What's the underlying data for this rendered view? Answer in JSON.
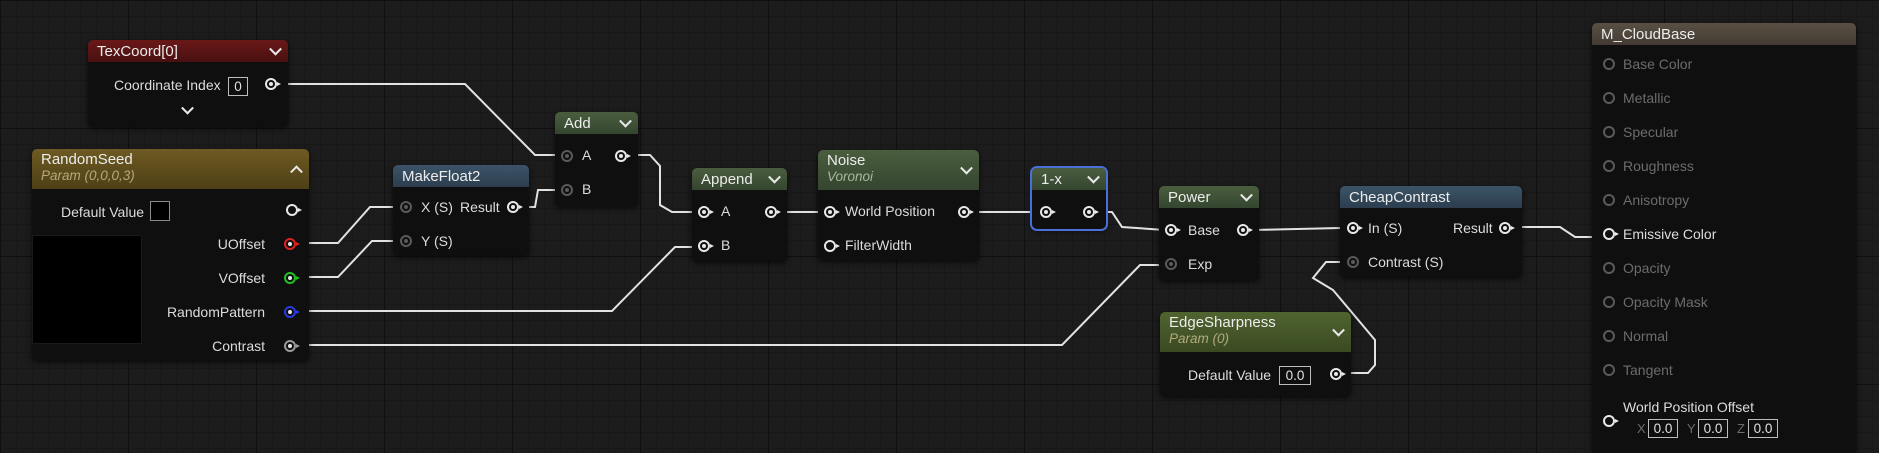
{
  "nodes": {
    "texcoord": {
      "title": "TexCoord[0]",
      "coordinate_index_label": "Coordinate Index",
      "coordinate_index_value": "0"
    },
    "random_seed": {
      "title": "RandomSeed",
      "subtitle": "Param (0,0,0,3)",
      "default_value_label": "Default Value",
      "outputs": [
        "UOffset",
        "VOffset",
        "RandomPattern",
        "Contrast"
      ]
    },
    "make_float2": {
      "title": "MakeFloat2",
      "inputs": [
        "X (S)",
        "Y (S)"
      ],
      "output": "Result"
    },
    "add": {
      "title": "Add",
      "inputs": [
        "A",
        "B"
      ]
    },
    "append": {
      "title": "Append",
      "inputs": [
        "A",
        "B"
      ]
    },
    "noise": {
      "title": "Noise",
      "subtitle": "Voronoi",
      "inputs": [
        "World Position",
        "FilterWidth"
      ]
    },
    "one_minus": {
      "title": "1-x"
    },
    "power": {
      "title": "Power",
      "inputs": [
        "Base",
        "Exp"
      ]
    },
    "edge_sharpness": {
      "title": "EdgeSharpness",
      "subtitle": "Param (0)",
      "default_value_label": "Default Value",
      "default_value": "0.0"
    },
    "cheap_contrast": {
      "title": "CheapContrast",
      "inputs": [
        "In (S)",
        "Contrast (S)"
      ],
      "output": "Result"
    },
    "material": {
      "title": "M_CloudBase",
      "inputs": [
        "Base Color",
        "Metallic",
        "Specular",
        "Roughness",
        "Anisotropy",
        "Emissive Color",
        "Opacity",
        "Opacity Mask",
        "Normal",
        "Tangent"
      ],
      "wpo_label": "World Position Offset",
      "wpo": {
        "x_label": "X",
        "x": "0.0",
        "y_label": "Y",
        "y": "0.0",
        "z_label": "Z",
        "z": "0.0"
      }
    }
  },
  "colors": {
    "texcoord_header": "#5a1414",
    "param_header": "#6a5520",
    "function_header": "#34485a",
    "math_header": "#3d5034",
    "edge_header": "#4a5c28",
    "material_header": "#4e463d",
    "pin_red": "#e02020",
    "pin_green": "#20c020",
    "pin_blue": "#2a3ae0",
    "pin_gray": "#9a9a9a",
    "wire": "#e8e8e8"
  }
}
